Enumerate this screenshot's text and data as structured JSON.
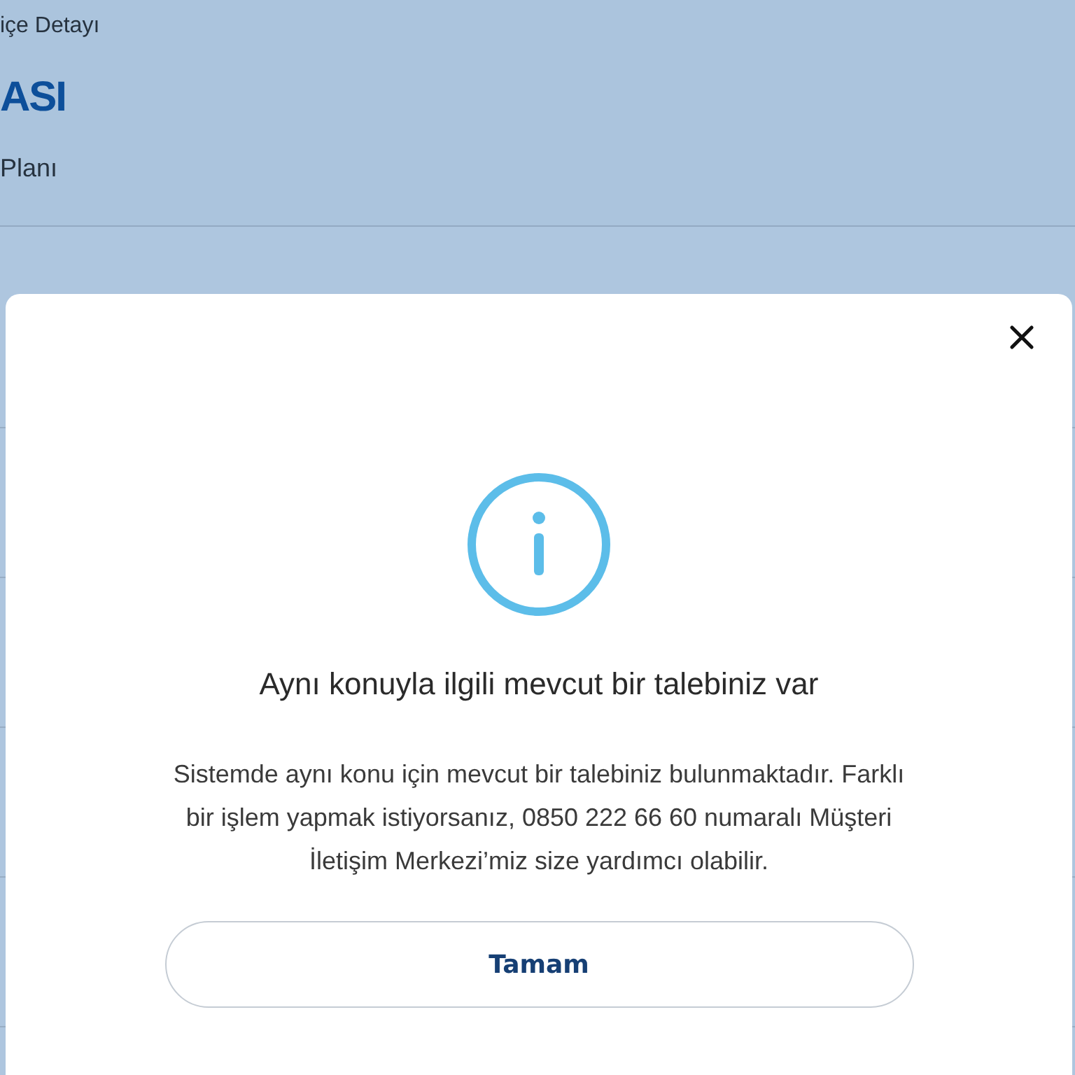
{
  "background_page": {
    "breadcrumb": "içe Detayı",
    "title": "ASI",
    "subtitle": "Planı"
  },
  "dialog": {
    "title": "Aynı konuyla ilgili mevcut bir talebiniz var",
    "message": "Sistemde aynı konu için mevcut bir talebiniz bulunmaktadır. Farklı bir işlem yapmak istiyorsanız, 0850 222 66 60 numaralı Müşteri İletişim Merkezi’miz size yardımcı olabilir.",
    "buttons": [
      "Tamam"
    ]
  }
}
